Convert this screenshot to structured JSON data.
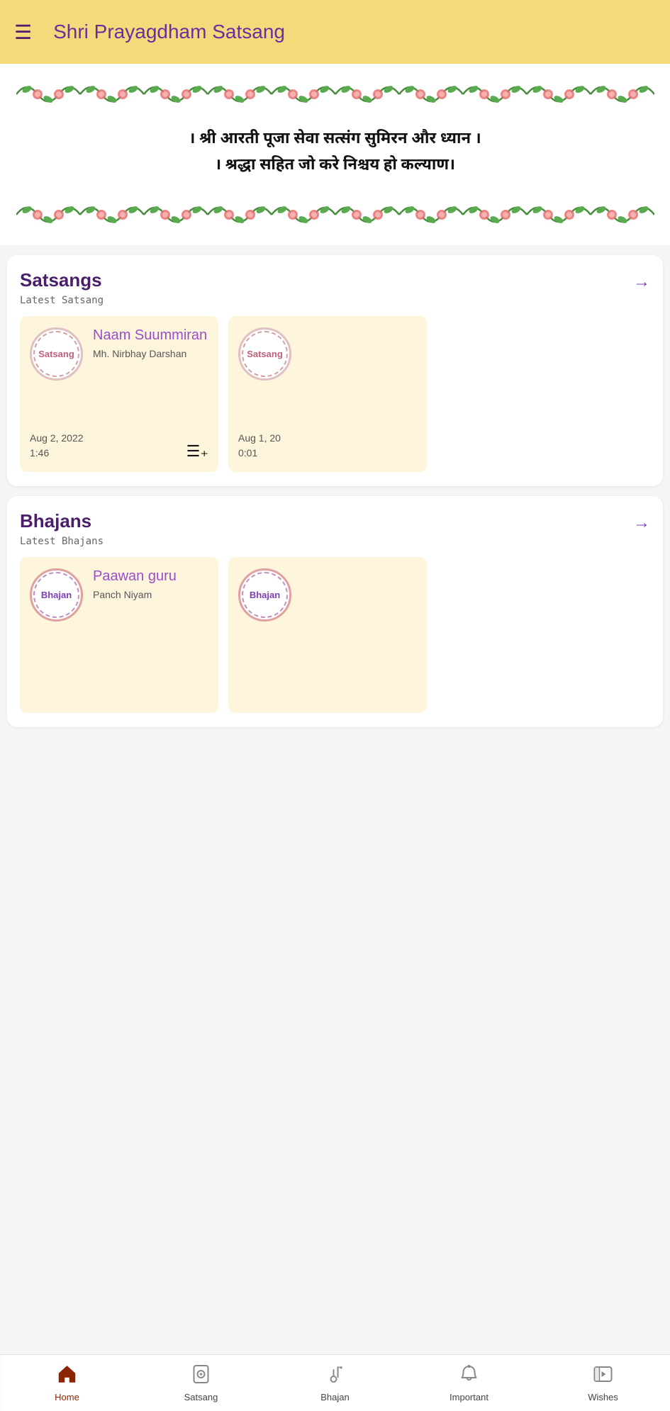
{
  "header": {
    "title": "Shri Prayagdham Satsang",
    "menu_icon": "☰"
  },
  "banner": {
    "line1": "। श्री आरती पूजा सेवा सत्संग सुमिरन और ध्यान ।",
    "line2": "। श्रद्धा सहित जो करे निश्चय हो कल्याण।"
  },
  "satsangs_section": {
    "title": "Satsangs",
    "subtitle": "Latest Satsang",
    "arrow": "→",
    "cards": [
      {
        "thumb_label": "Satsang",
        "title": "Naam Suummiran",
        "artist": "Mh. Nirbhay Darshan",
        "date": "Aug 2, 2022",
        "duration": "1:46",
        "show_add_icon": true
      },
      {
        "thumb_label": "Satsang",
        "title": "",
        "artist": "",
        "date": "Aug 1, 20",
        "duration": "0:01",
        "show_add_icon": false
      }
    ]
  },
  "bhajans_section": {
    "title": "Bhajans",
    "subtitle": "Latest Bhajans",
    "arrow": "→",
    "cards": [
      {
        "thumb_label": "Bhajan",
        "title": "Paawan guru",
        "artist": "Panch Niyam",
        "date": "",
        "duration": "",
        "show_add_icon": false
      },
      {
        "thumb_label": "Bhajan",
        "title": "",
        "artist": "",
        "date": "",
        "duration": "",
        "show_add_icon": false
      }
    ]
  },
  "bottom_nav": {
    "items": [
      {
        "id": "home",
        "label": "Home",
        "icon": "🏠",
        "active": true
      },
      {
        "id": "satsang",
        "label": "Satsang",
        "icon": "📄",
        "active": false
      },
      {
        "id": "bhajan",
        "label": "Bhajan",
        "icon": "🎵",
        "active": false
      },
      {
        "id": "important",
        "label": "Important",
        "icon": "🔔",
        "active": false
      },
      {
        "id": "wishes",
        "label": "Wishes",
        "icon": "▶",
        "active": false
      }
    ]
  },
  "floral_repeat": "🌸🌿🌸🌿🌸🌿🌸🌿🌸🌿🌸🌿🌸🌿🌸🌿🌸🌿🌸"
}
